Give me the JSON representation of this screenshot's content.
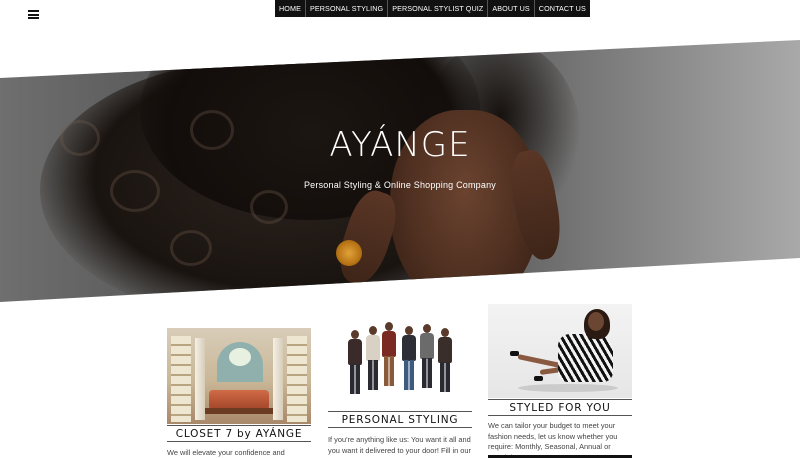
{
  "nav": {
    "items": [
      "HOME",
      "PERSONAL STYLING",
      "PERSONAL STYLIST QUIZ",
      "ABOUT US",
      "CONTACT US"
    ]
  },
  "hero": {
    "title": "AYÁNGE",
    "subtitle": "Personal Styling & Online Shopping Company"
  },
  "cards": [
    {
      "title": "CLOSET 7 by AYÁNGE",
      "text": "We will elevate your confidence and change"
    },
    {
      "title": "PERSONAL STYLING",
      "text": "If you're anything like us: You want it all and you want it delivered to your door! Fill in our"
    },
    {
      "title": "STYLED FOR YOU",
      "text": "We can tailor your budget to meet your fashion needs, let us know whether you require: Monthly, Seasonal, Annual or Special event."
    }
  ],
  "colors": {
    "nav_bg": "#111111",
    "nav_text": "#ffffff",
    "hero_text": "#ffffff",
    "title_border": "#555555"
  },
  "icons": {
    "menu": "hamburger-icon"
  }
}
